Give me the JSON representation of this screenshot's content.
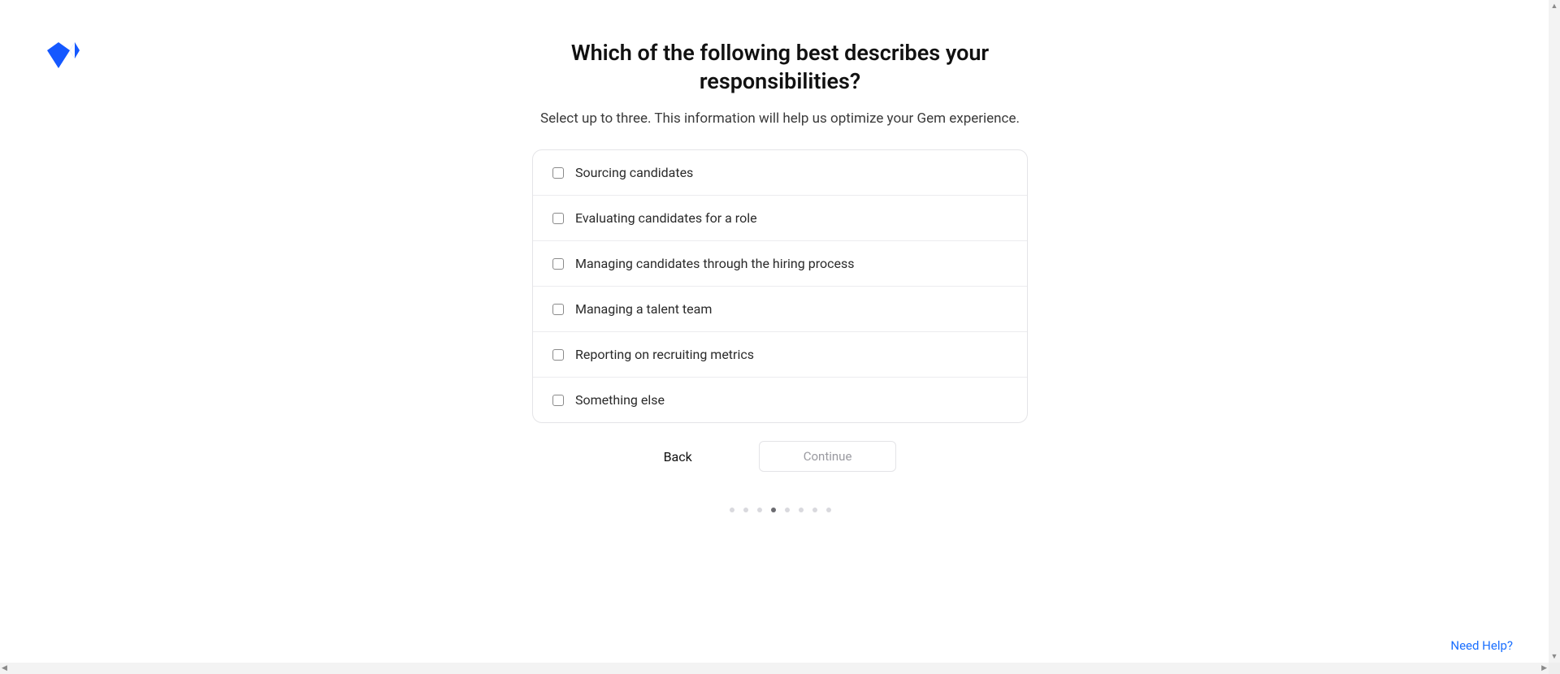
{
  "brand": {
    "accent": "#1558ff"
  },
  "question": {
    "title": "Which of the following best describes your responsibilities?",
    "subtitle": "Select up to three. This information will help us optimize your Gem experience."
  },
  "options": [
    {
      "label": "Sourcing candidates",
      "checked": false
    },
    {
      "label": "Evaluating candidates for a role",
      "checked": false
    },
    {
      "label": "Managing candidates through the hiring process",
      "checked": false
    },
    {
      "label": "Managing a talent team",
      "checked": false
    },
    {
      "label": "Reporting on recruiting metrics",
      "checked": false
    },
    {
      "label": "Something else",
      "checked": false
    }
  ],
  "actions": {
    "back": "Back",
    "continue": "Continue"
  },
  "progress": {
    "total": 8,
    "current": 4
  },
  "footer": {
    "help": "Need Help?"
  }
}
